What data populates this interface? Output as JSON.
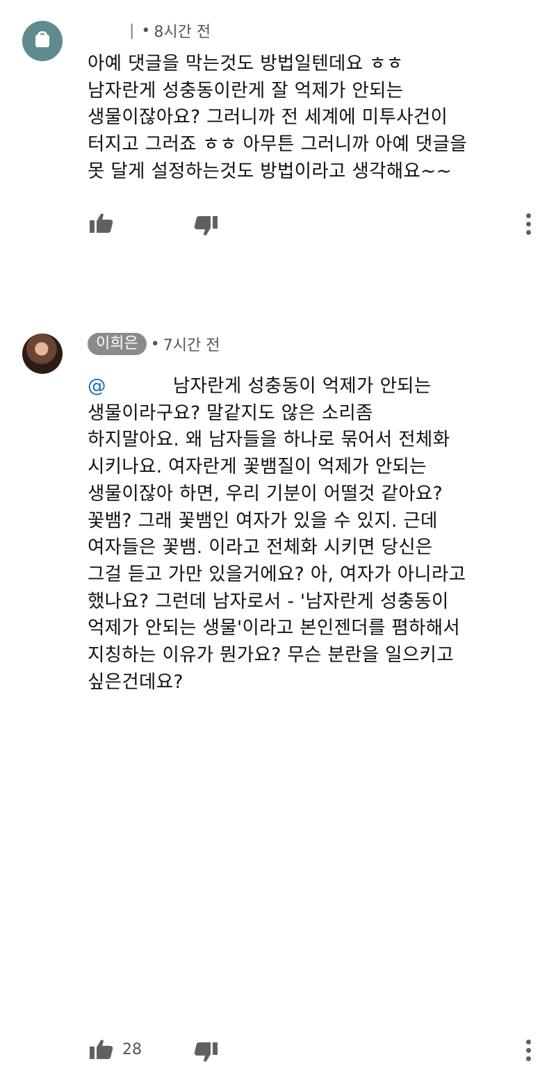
{
  "comments": [
    {
      "author": "",
      "time": "8시간 전",
      "separator": "•",
      "lines": [
        "아예 댓글을 막는것도 방법일텐데요 ㅎㅎ",
        "남자란게 성충동이란게 잘 억제가 안되는",
        "생물이잖아요? 그러니까 전 세계에 미투사건이",
        "터지고 그러죠 ㅎㅎ 아무튼 그러니까 아예 댓글을",
        "못 달게 설정하는것도 방법이라고 생각해요~~"
      ],
      "like_count": "",
      "avatar_icon": "lock-icon",
      "avatar_color": "#5f8a90"
    },
    {
      "author": "이희은",
      "time": "7시간 전",
      "separator": "•",
      "mention": "@",
      "first_line_text": "남자란게 성충동이 억제가 안되는",
      "lines": [
        "생물이라구요? 말같지도 않은 소리좀",
        "하지말아요. 왜 남자들을 하나로 묶어서 전체화",
        "시키나요. 여자란게 꽃뱀질이 억제가 안되는",
        "생물이잖아 하면, 우리 기분이 어떨것 같아요?",
        "꽃뱀? 그래 꽃뱀인 여자가 있을 수 있지. 근데",
        "여자들은 꽃뱀. 이라고 전체화 시키면 당신은",
        "그걸 듣고 가만 있을거에요? 아, 여자가 아니라고",
        "했나요? 그런데 남자로서 - '남자란게 성충동이",
        "억제가 안되는 생물'이라고 본인젠더를 폄하해서",
        "지칭하는 이유가 뭔가요? 무슨 분란을 일으키고",
        "싶은건데요?"
      ],
      "like_count": "28",
      "mention_color": "#1a6fb0"
    }
  ],
  "icons": {
    "like": "thumbs-up-icon",
    "dislike": "thumbs-down-icon",
    "more": "more-vert-icon"
  }
}
